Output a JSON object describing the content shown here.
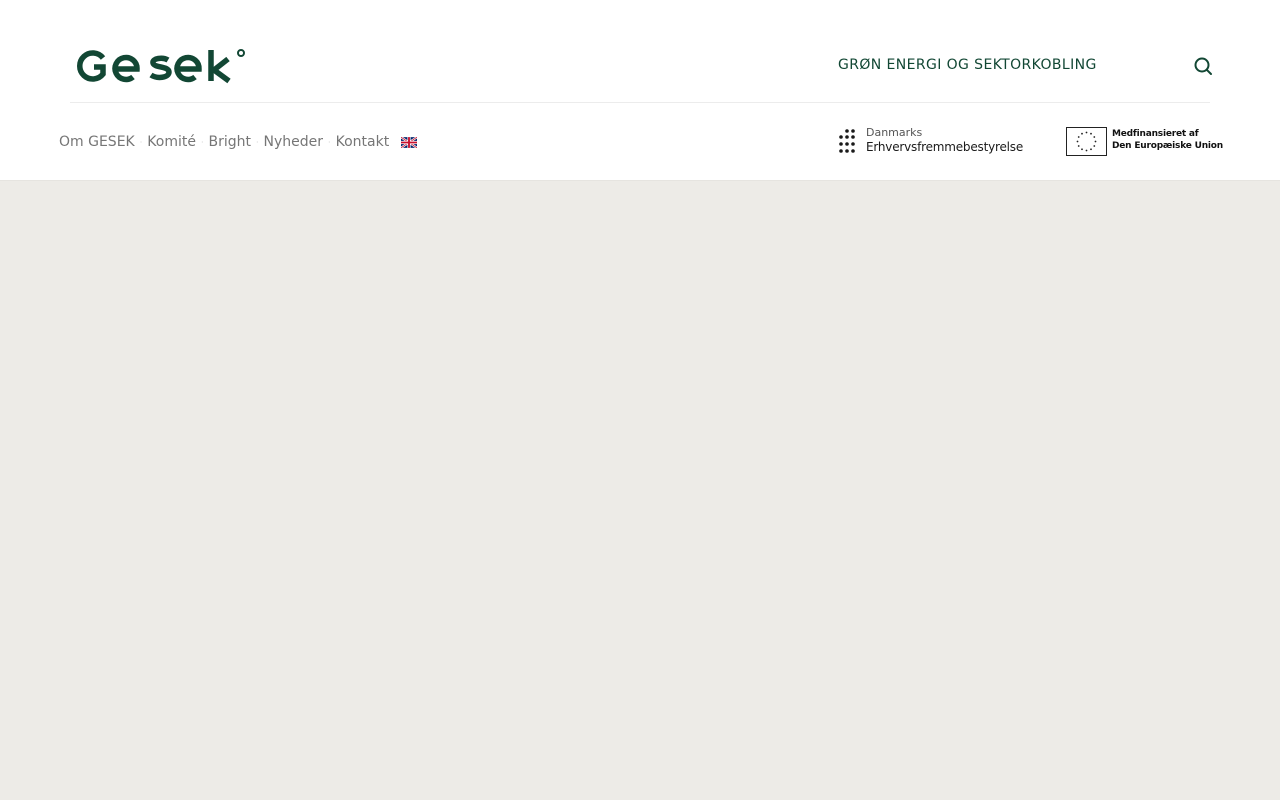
{
  "site": {
    "logo_text": "GESEK",
    "tagline": "GRØN ENERGI OG SEKTORKOBLING",
    "brand_color": "#124734"
  },
  "search": {
    "icon": "search-icon"
  },
  "nav": {
    "items": [
      {
        "label": "Om GESEK"
      },
      {
        "label": "Komité"
      },
      {
        "label": "Bright"
      },
      {
        "label": "Nyheder"
      },
      {
        "label": "Kontakt"
      }
    ],
    "language_icon": "uk-flag-icon"
  },
  "partners": {
    "erhverv": {
      "line1": "Danmarks",
      "line2": "Erhvervsfremmebestyrelse"
    },
    "eu": {
      "line1": "Medfinansieret af",
      "line2": "Den Europæiske Union"
    }
  },
  "colors": {
    "header_bg": "#ffffff",
    "content_bg": "#edebe7",
    "nav_text": "#767676"
  }
}
